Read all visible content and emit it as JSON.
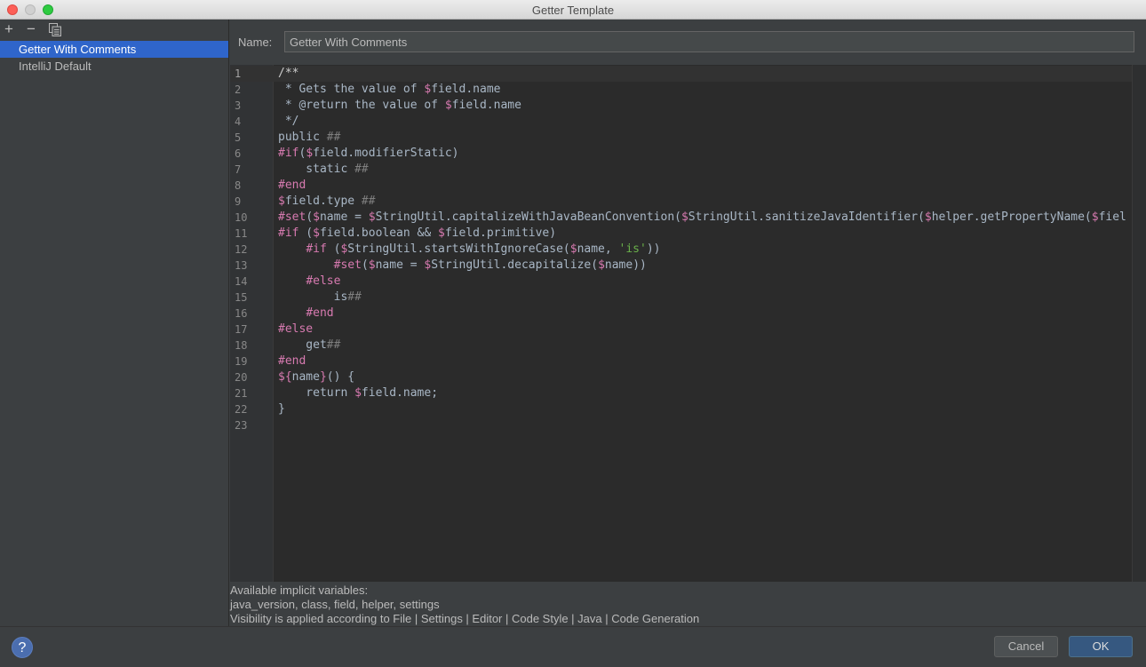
{
  "window": {
    "title": "Getter Template"
  },
  "toolbar": {
    "add_icon": "+",
    "remove_icon": "−",
    "copy_icon": "⧉"
  },
  "templates": [
    {
      "label": "Getter With Comments",
      "selected": true
    },
    {
      "label": "IntelliJ Default",
      "selected": false
    }
  ],
  "name_field": {
    "label": "Name:",
    "value": "Getter With Comments"
  },
  "editor": {
    "current_line": 1,
    "lines": [
      "1",
      "2",
      "3",
      "4",
      "5",
      "6",
      "7",
      "8",
      "9",
      "10",
      "11",
      "12",
      "13",
      "14",
      "15",
      "16",
      "17",
      "18",
      "19",
      "20",
      "21",
      "22",
      "23"
    ]
  },
  "info": {
    "line1": "Available implicit variables:",
    "line2": "java_version, class, field, helper, settings",
    "line3": "Visibility is applied according to File | Settings | Editor | Code Style | Java | Code Generation"
  },
  "footer": {
    "help_label": "?",
    "cancel_label": "Cancel",
    "ok_label": "OK"
  },
  "colors": {
    "selection": "#2f65ca",
    "ok_button": "#365880",
    "velocity_var": "#d77ab0",
    "string": "#6ab04a"
  }
}
